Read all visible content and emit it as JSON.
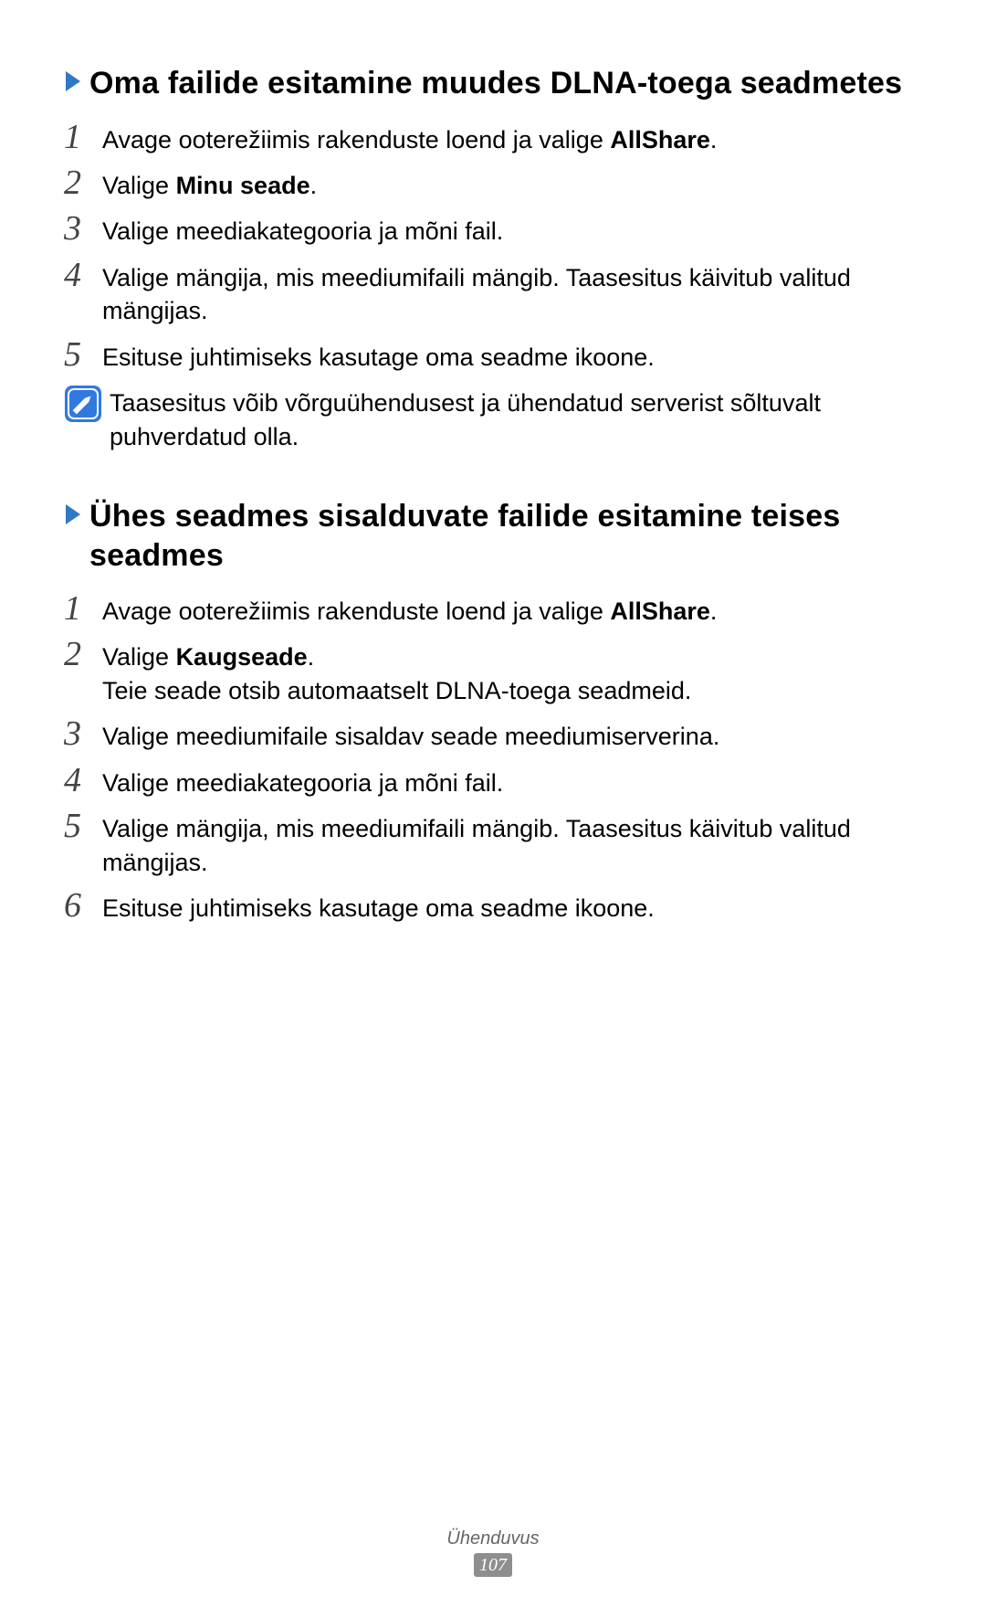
{
  "section1": {
    "heading": "Oma failide esitamine muudes DLNA-toega seadmetes",
    "steps": [
      {
        "n": "1",
        "pre": "Avage ooterežiimis rakenduste loend ja valige ",
        "bold": "AllShare",
        "post": "."
      },
      {
        "n": "2",
        "pre": "Valige ",
        "bold": "Minu seade",
        "post": "."
      },
      {
        "n": "3",
        "pre": "Valige meediakategooria ja mõni fail.",
        "bold": "",
        "post": ""
      },
      {
        "n": "4",
        "pre": "Valige mängija, mis meediumifaili mängib. Taasesitus käivitub valitud mängijas.",
        "bold": "",
        "post": ""
      },
      {
        "n": "5",
        "pre": "Esituse juhtimiseks kasutage oma seadme ikoone.",
        "bold": "",
        "post": ""
      }
    ],
    "note": "Taasesitus võib võrguühendusest ja ühendatud serverist sõltuvalt puhverdatud olla."
  },
  "section2": {
    "heading": "Ühes seadmes sisalduvate failide esitamine teises seadmes",
    "steps": [
      {
        "n": "1",
        "pre": "Avage ooterežiimis rakenduste loend ja valige ",
        "bold": "AllShare",
        "post": "."
      },
      {
        "n": "2",
        "pre": "Valige ",
        "bold": "Kaugseade",
        "post": ".",
        "extra": "Teie seade otsib automaatselt DLNA-toega seadmeid."
      },
      {
        "n": "3",
        "pre": "Valige meediumifaile sisaldav seade meediumiserverina.",
        "bold": "",
        "post": ""
      },
      {
        "n": "4",
        "pre": "Valige meediakategooria ja mõni fail.",
        "bold": "",
        "post": ""
      },
      {
        "n": "5",
        "pre": "Valige mängija, mis meediumifaili mängib. Taasesitus käivitub valitud mängijas.",
        "bold": "",
        "post": ""
      },
      {
        "n": "6",
        "pre": "Esituse juhtimiseks kasutage oma seadme ikoone.",
        "bold": "",
        "post": ""
      }
    ]
  },
  "footer": {
    "category": "Ühenduvus",
    "page": "107"
  }
}
